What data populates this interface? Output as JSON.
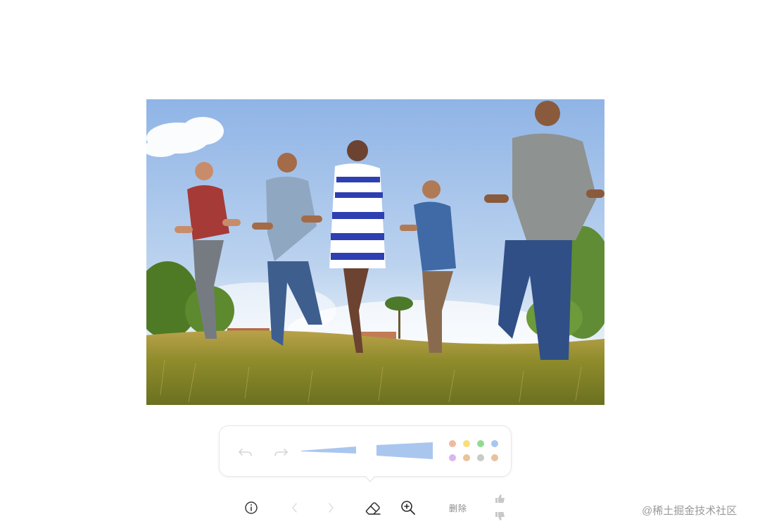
{
  "toolbar": {
    "delete_label": "删除"
  },
  "brush_panel": {
    "colors": [
      "#f2b9a0",
      "#f7df7a",
      "#90dc8c",
      "#a9c6f0",
      "#d8b7f1",
      "#e9c39b",
      "#c9cbc7",
      "#e7c2a0"
    ]
  },
  "watermark": "@稀土掘金技术社区"
}
